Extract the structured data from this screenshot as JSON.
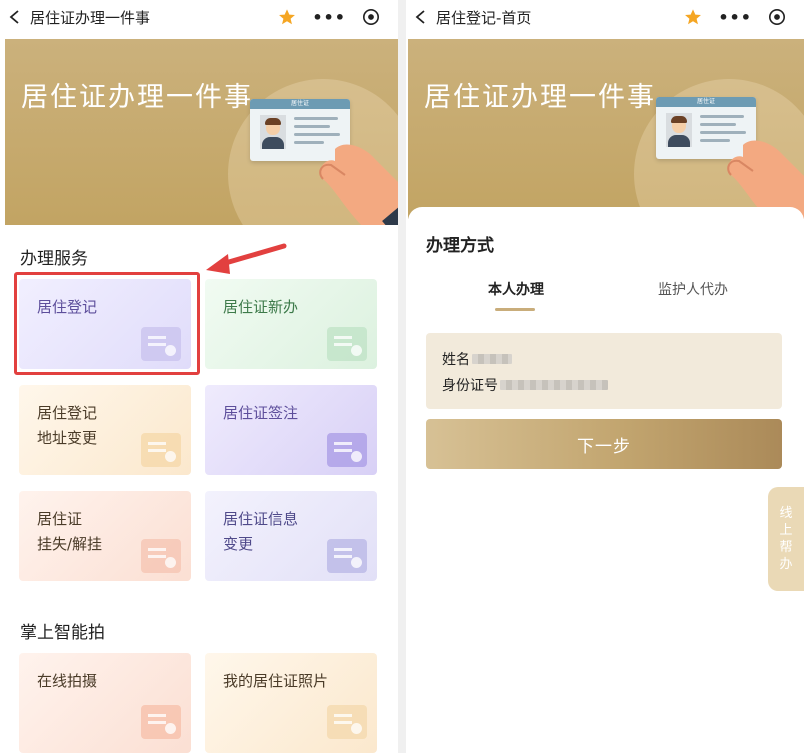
{
  "left": {
    "nav": {
      "title": "居住证办理一件事"
    },
    "banner": {
      "title": "居住证办理一件事",
      "card_label": "居住证"
    },
    "section1": "办理服务",
    "tiles": [
      {
        "l1": "居住登记",
        "l2": ""
      },
      {
        "l1": "居住证新办",
        "l2": ""
      },
      {
        "l1": "居住登记",
        "l2": "地址变更"
      },
      {
        "l1": "居住证签注",
        "l2": ""
      },
      {
        "l1": "居住证",
        "l2": "挂失/解挂"
      },
      {
        "l1": "居住证信息",
        "l2": "变更"
      }
    ],
    "section2": "掌上智能拍",
    "tiles2": [
      {
        "l1": "在线拍摄"
      },
      {
        "l1": "我的居住证照片"
      }
    ]
  },
  "right": {
    "nav": {
      "title": "居住登记-首页"
    },
    "banner": {
      "title": "居住证办理一件事",
      "card_label": "居住证"
    },
    "sheet_title": "办理方式",
    "tabs": [
      "本人办理",
      "监护人代办"
    ],
    "name_label": "姓名",
    "id_label": "身份证号",
    "next_button": "下一步",
    "help_chars": [
      "线",
      "上",
      "帮",
      "办"
    ]
  },
  "colors": {
    "accent_gold": "#c2a463",
    "highlight_red": "#e2403f",
    "star": "#f5a623"
  },
  "icons": [
    "back-arrow-icon",
    "star-icon",
    "more-icon",
    "target-icon",
    "camera-icon",
    "photo-icon"
  ]
}
